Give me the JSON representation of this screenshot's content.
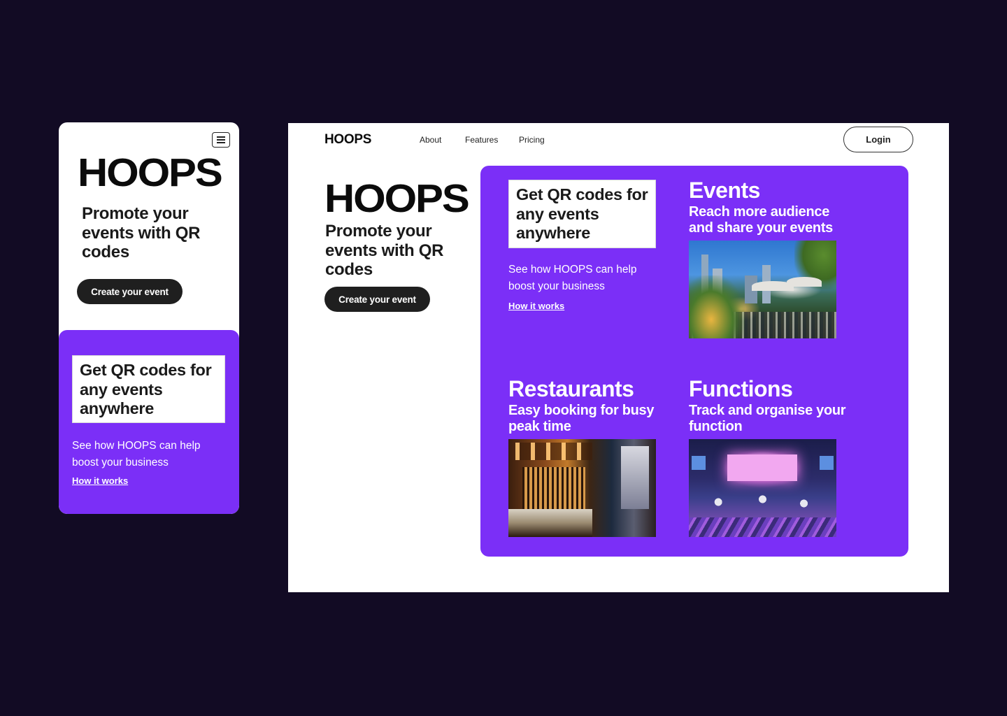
{
  "brand": {
    "name": "HOOPS"
  },
  "mobile": {
    "logo": "HOOPS",
    "tagline": "Promote your events with QR codes",
    "cta": "Create  your event",
    "qr_heading": "Get QR codes for any events anywhere",
    "help_text": "See how HOOPS can help boost your business",
    "how_link": "How it works"
  },
  "desktop": {
    "logo": "HOOPS",
    "nav": [
      {
        "label": "About"
      },
      {
        "label": "Features"
      },
      {
        "label": "Pricing"
      }
    ],
    "login": "Login",
    "hero_logo": "HOOPS",
    "tagline": "Promote your events with QR codes",
    "cta": "Create  your event",
    "qr_heading": "Get QR codes for any events anywhere",
    "help_text": "See how HOOPS can help boost your business",
    "how_link": "How it works",
    "cards": [
      {
        "title": "Events",
        "subtitle": "Reach more audience and share your events"
      },
      {
        "title": "Restaurants",
        "subtitle": "Easy booking for busy peak time"
      },
      {
        "title": "Functions",
        "subtitle": "Track and organise your function"
      }
    ]
  },
  "colors": {
    "background": "#120b24",
    "accent_purple": "#7b2ff7",
    "button_dark": "#1f1f1f"
  },
  "icons": [
    "menu-icon"
  ]
}
